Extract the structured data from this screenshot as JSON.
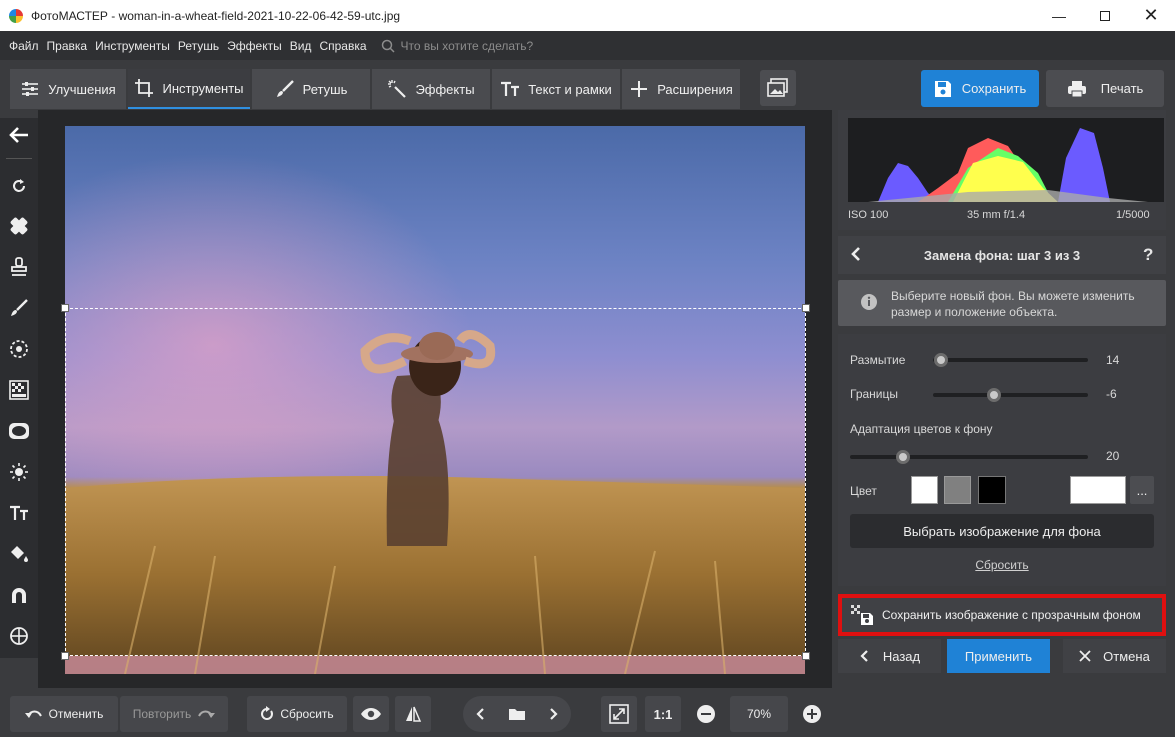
{
  "window": {
    "title": "ФотоМАСТЕР - woman-in-a-wheat-field-2021-10-22-06-42-59-utc.jpg"
  },
  "menu": {
    "items": [
      "Файл",
      "Правка",
      "Инструменты",
      "Ретушь",
      "Эффекты",
      "Вид",
      "Справка"
    ],
    "search_placeholder": "Что вы хотите сделать?"
  },
  "tabs": [
    {
      "label": "Улучшения",
      "icon": "sliders-icon"
    },
    {
      "label": "Инструменты",
      "icon": "crop-icon"
    },
    {
      "label": "Ретушь",
      "icon": "brush-icon"
    },
    {
      "label": "Эффекты",
      "icon": "magic-wand-icon"
    },
    {
      "label": "Текст и рамки",
      "icon": "text-icon"
    },
    {
      "label": "Расширения",
      "icon": "plus-icon"
    }
  ],
  "toolbar_right": {
    "save_label": "Сохранить",
    "print_label": "Печать"
  },
  "histogram": {
    "iso": "ISO 100",
    "lens": "35 mm f/1.4",
    "shutter": "1/5000"
  },
  "step_panel": {
    "title": "Замена фона: шаг 3 из 3",
    "help": "?"
  },
  "info": {
    "text": "Выберите новый фон. Вы можете изменить размер и положение объекта."
  },
  "controls": {
    "blur_label": "Размытие",
    "blur_value": "14",
    "blur_level": 14,
    "edges_label": "Границы",
    "edges_value": "-6",
    "edges_level": -6,
    "adapt_label": "Адаптация цветов к фону",
    "adapt_value": "20",
    "adapt_level": 20,
    "color_label": "Цвет",
    "swatches": [
      "#ffffff",
      "#808080",
      "#000000"
    ],
    "custom_color": "#ffffff",
    "more_label": "...",
    "choose_bg_label": "Выбрать изображение для фона",
    "reset_link": "Сбросить"
  },
  "save_transparent_label": "Сохранить изображение с прозрачным фоном",
  "actions": {
    "back": "Назад",
    "apply": "Применить",
    "cancel": "Отмена"
  },
  "bottom": {
    "undo": "Отменить",
    "redo": "Повторить",
    "reset": "Сбросить",
    "ratio": "1:1",
    "zoom": "70%"
  },
  "colors": {
    "accent": "#2f8fe0",
    "highlight_border": "#e01010"
  }
}
